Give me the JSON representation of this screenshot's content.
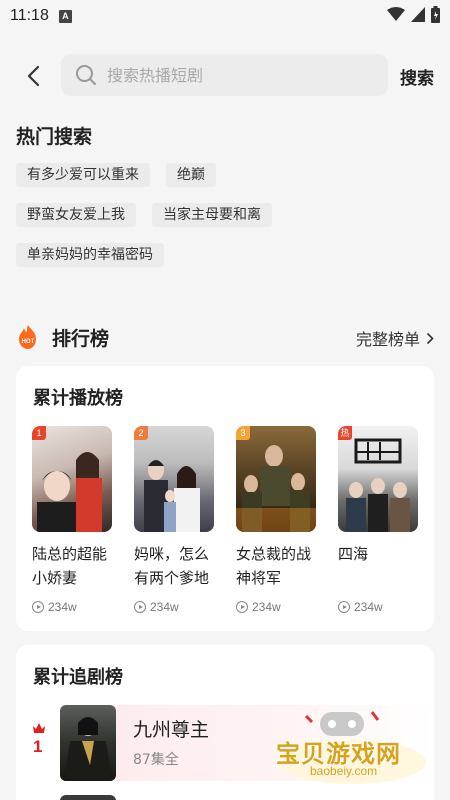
{
  "status": {
    "time": "11:18",
    "notif_letter": "A"
  },
  "search": {
    "placeholder": "搜索热播短剧",
    "button": "搜索"
  },
  "hot": {
    "title": "热门搜索",
    "rows": [
      [
        "有多少爱可以重来",
        "绝巅"
      ],
      [
        "野蛮女友爱上我",
        "当家主母要和离"
      ],
      [
        "单亲妈妈的幸福密码"
      ]
    ]
  },
  "rank": {
    "badge_text": "HOT",
    "title": "排行榜",
    "more": "完整榜单"
  },
  "plays_card": {
    "title": "累计播放榜",
    "items": [
      {
        "badge": "1",
        "name": "陆总的超能小娇妻",
        "plays": "234w",
        "badge_color": "#e8452c"
      },
      {
        "badge": "2",
        "name": "妈咪，怎么有两个爹地",
        "plays": "234w",
        "badge_color": "#f07b3a"
      },
      {
        "badge": "3",
        "name": "女总裁的战神将军",
        "plays": "234w",
        "badge_color": "#f3a53a"
      },
      {
        "badge": "热",
        "name": "四海",
        "plays": "234w",
        "badge_color": "#e8452c"
      }
    ]
  },
  "follow_card": {
    "title": "累计追剧榜",
    "items": [
      {
        "rank": "1",
        "name": "九州尊主",
        "eps": "87集全"
      }
    ]
  },
  "watermark": {
    "text": "宝贝游戏网",
    "url": "baobeiy.com"
  },
  "colors": {
    "accent": "#e02020",
    "watermark": "#d9a21a"
  }
}
